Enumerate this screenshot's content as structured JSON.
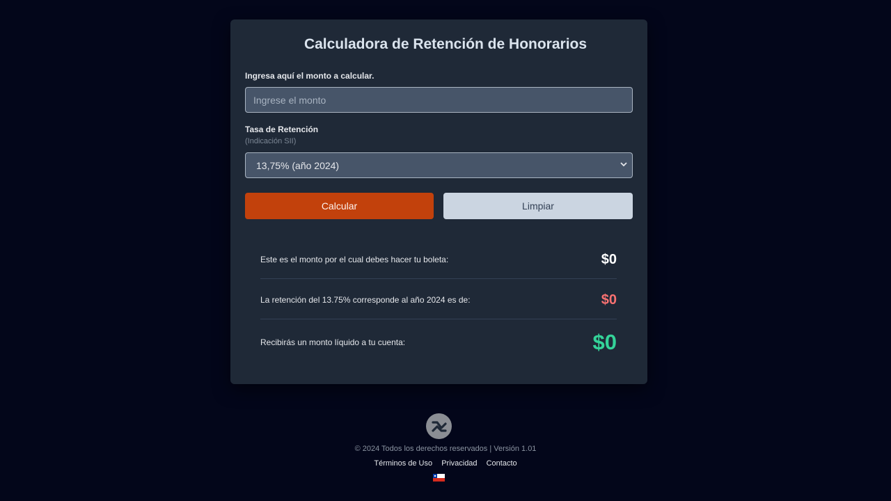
{
  "calculator": {
    "title": "Calculadora de Retención de Honorarios",
    "amount_label": "Ingresa aquí el monto a calcular.",
    "amount_placeholder": "Ingrese el monto",
    "amount_value": "",
    "rate_label": "Tasa de Retención",
    "rate_sublabel": "(Indicación SII)",
    "rate_selected": "13,75% (año 2024)",
    "calculate_label": "Calcular",
    "clear_label": "Limpiar"
  },
  "results": [
    {
      "text": "Este es el monto por el cual debes hacer tu boleta:",
      "value": "$0",
      "color": "#ffffff"
    },
    {
      "text": "La retención del 13.75% corresponde al año 2024 es de:",
      "value": "$0",
      "color": "#f87171"
    },
    {
      "text": "Recibirás un monto líquido a tu cuenta:",
      "value": "$0",
      "color": "#34d399"
    }
  ],
  "footer": {
    "logo_icon": "brand-logo-icon",
    "copyright": "© 2024 Todos los derechos reservados | Versión 1.01",
    "links": [
      "Términos de Uso",
      "Privacidad",
      "Contacto"
    ],
    "flag_icon": "chile-flag-icon"
  },
  "colors": {
    "background": "#03061a",
    "card": "#1f2937",
    "primary_button": "#c2410c",
    "secondary_button": "#cbd5e1",
    "positive": "#34d399",
    "negative": "#f87171"
  }
}
